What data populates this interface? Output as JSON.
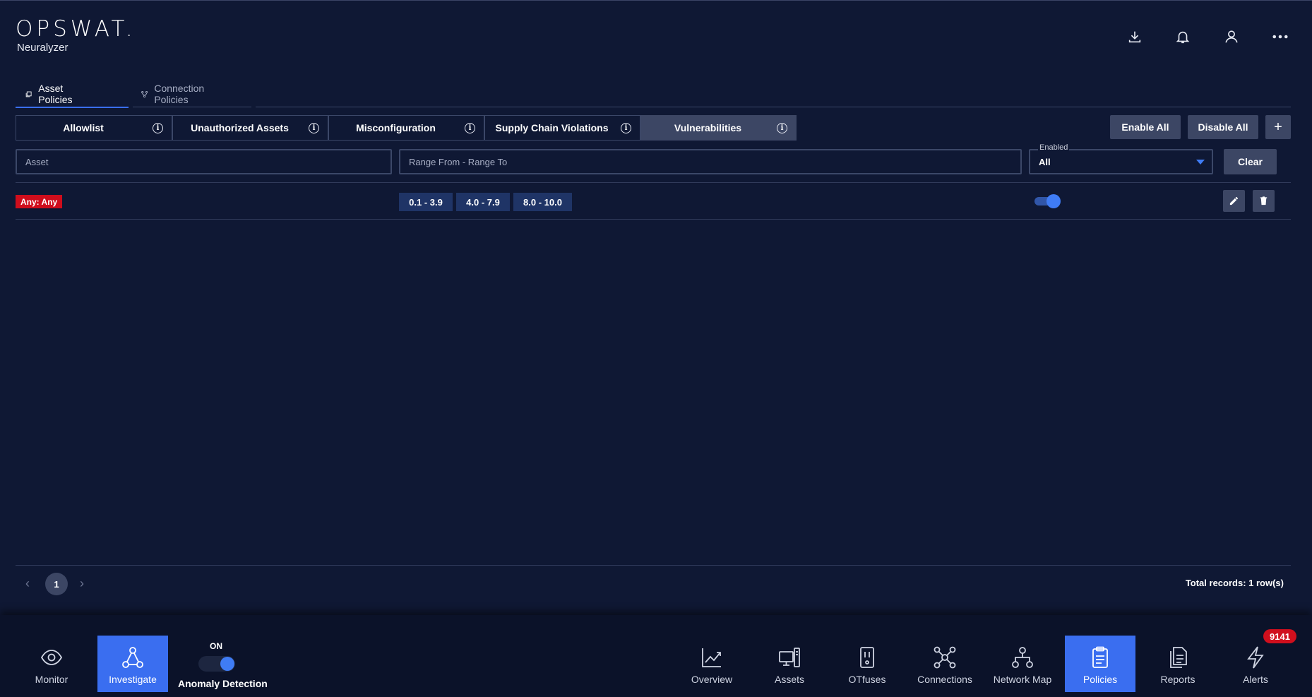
{
  "app": {
    "logo": "OPSWAT.",
    "product": "Neuralyzer"
  },
  "header_icons": [
    "download-icon",
    "bell-icon",
    "user-icon",
    "more-icon"
  ],
  "top_tabs": [
    {
      "label": "Asset Policies",
      "active": true
    },
    {
      "label": "Connection Policies",
      "active": false
    }
  ],
  "category_tabs": [
    {
      "label": "Allowlist"
    },
    {
      "label": "Unauthorized Assets"
    },
    {
      "label": "Misconfiguration"
    },
    {
      "label": "Supply Chain Violations"
    },
    {
      "label": "Vulnerabilities",
      "active": true
    }
  ],
  "actions": {
    "enable_all": "Enable All",
    "disable_all": "Disable All",
    "add": "+"
  },
  "filters": {
    "asset_placeholder": "Asset",
    "range_placeholder": "Range From - Range To",
    "enabled_label": "Enabled",
    "enabled_value": "All",
    "clear": "Clear"
  },
  "rows": [
    {
      "asset": "Any: Any",
      "ranges": [
        "0.1 - 3.9",
        "4.0 - 7.9",
        "8.0 - 10.0"
      ],
      "enabled": true
    }
  ],
  "pagination": {
    "page": "1",
    "total": "Total records: 1 row(s)"
  },
  "bottom_nav": {
    "left": [
      {
        "label": "Monitor",
        "icon": "eye-icon"
      },
      {
        "label": "Investigate",
        "icon": "hierarchy-icon",
        "active": true
      }
    ],
    "anomaly": {
      "state": "ON",
      "label": "Anomaly Detection"
    },
    "right": [
      {
        "label": "Overview",
        "icon": "chart-icon"
      },
      {
        "label": "Assets",
        "icon": "devices-icon"
      },
      {
        "label": "OTfuses",
        "icon": "fuse-icon"
      },
      {
        "label": "Connections",
        "icon": "network-icon"
      },
      {
        "label": "Network Map",
        "icon": "map-icon"
      },
      {
        "label": "Policies",
        "icon": "clipboard-icon",
        "active": true
      },
      {
        "label": "Reports",
        "icon": "reports-icon"
      },
      {
        "label": "Alerts",
        "icon": "bolt-icon"
      }
    ],
    "alerts_count": "9141"
  },
  "colors": {
    "background": "#0f1834",
    "accent": "#3a6ef0",
    "danger": "#cf0d1c",
    "chip": "#1f3466"
  }
}
